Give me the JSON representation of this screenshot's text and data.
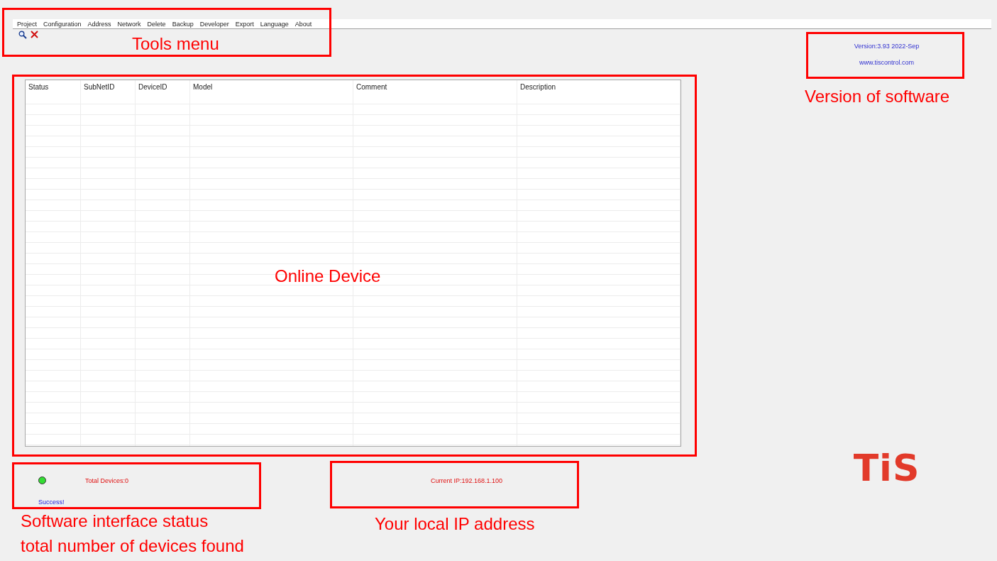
{
  "menu": [
    "Project",
    "Configuration",
    "Address",
    "Network",
    "Delete",
    "Backup",
    "Developer",
    "Export",
    "Language",
    "About"
  ],
  "table": {
    "columns": [
      "Status",
      "SubNetID",
      "DeviceID",
      "Model",
      "Comment",
      "Description"
    ]
  },
  "version": {
    "text": "Version:3.93 2022-Sep",
    "website": "www.tiscontrol.com"
  },
  "status": {
    "color": "#33dd33",
    "total_devices": "Total Devices:0",
    "message": "Success!"
  },
  "current_ip": "Current IP:192.168.1.100",
  "logo": "TiS",
  "annotations": [
    {
      "lines": [
        "Tools menu"
      ]
    },
    {
      "lines": [
        "Online Device"
      ]
    },
    {
      "lines": [
        "Version of software"
      ]
    },
    {
      "lines": [
        "Software interface status",
        "total number of devices found"
      ]
    },
    {
      "lines": [
        "Your local IP address"
      ]
    }
  ]
}
